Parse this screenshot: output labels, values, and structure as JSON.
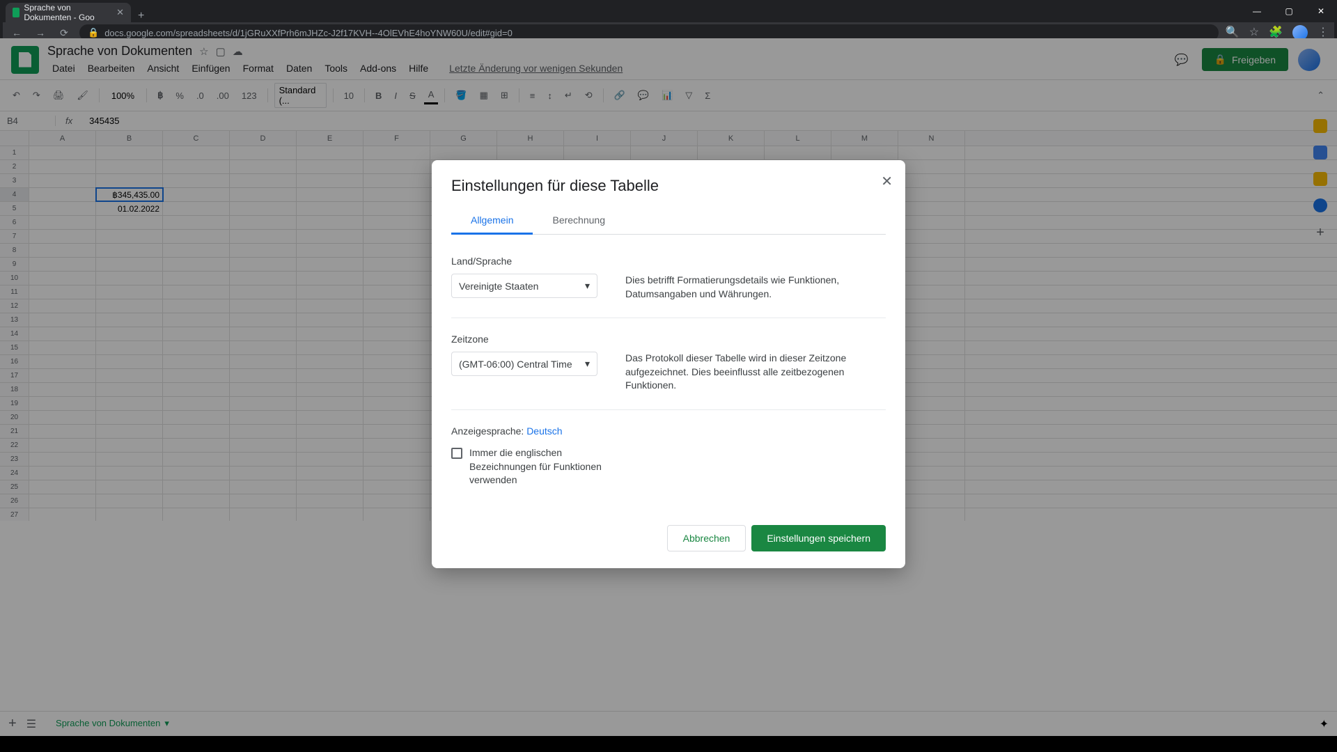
{
  "browser": {
    "tab_title": "Sprache von Dokumenten - Goo",
    "url": "docs.google.com/spreadsheets/d/1jGRuXXfPrh6mJHZc-J2f17KVH--4OlEVhE4hoYNW60U/edit#gid=0"
  },
  "header": {
    "doc_title": "Sprache von Dokumenten",
    "share_label": "Freigeben",
    "last_edit": "Letzte Änderung vor wenigen Sekunden"
  },
  "menu": {
    "items": [
      "Datei",
      "Bearbeiten",
      "Ansicht",
      "Einfügen",
      "Format",
      "Daten",
      "Tools",
      "Add-ons",
      "Hilfe"
    ]
  },
  "toolbar": {
    "zoom": "100%",
    "decimals": ".0",
    "decimals2": ".00",
    "number_format": "123",
    "font": "Standard (...",
    "font_size": "10"
  },
  "formula_bar": {
    "cell_ref": "B4",
    "fx": "fx",
    "value": "345435"
  },
  "grid": {
    "columns": [
      "A",
      "B",
      "C",
      "D",
      "E",
      "F",
      "G",
      "H",
      "I",
      "J",
      "K",
      "L",
      "M",
      "N"
    ],
    "row_count": 28,
    "selected_cell": {
      "row": 4,
      "col": "B",
      "value": "฿345,435.00"
    },
    "b5_value": "01.02.2022"
  },
  "sheet_tabs": {
    "active": "Sprache von Dokumenten"
  },
  "modal": {
    "title": "Einstellungen für diese Tabelle",
    "tabs": {
      "general": "Allgemein",
      "calc": "Berechnung"
    },
    "locale": {
      "label": "Land/Sprache",
      "value": "Vereinigte Staaten",
      "desc": "Dies betrifft Formatierungsdetails wie Funktionen, Datumsangaben und Währungen."
    },
    "timezone": {
      "label": "Zeitzone",
      "value": "(GMT-06:00) Central Time",
      "desc": "Das Protokoll dieser Tabelle wird in dieser Zeitzone aufgezeichnet. Dies beeinflusst alle zeitbezogenen Funktionen."
    },
    "display_lang": {
      "label": "Anzeigesprache:",
      "value": "Deutsch"
    },
    "checkbox_label": "Immer die englischen Bezeichnungen für Funktionen verwenden",
    "cancel": "Abbrechen",
    "save": "Einstellungen speichern"
  }
}
